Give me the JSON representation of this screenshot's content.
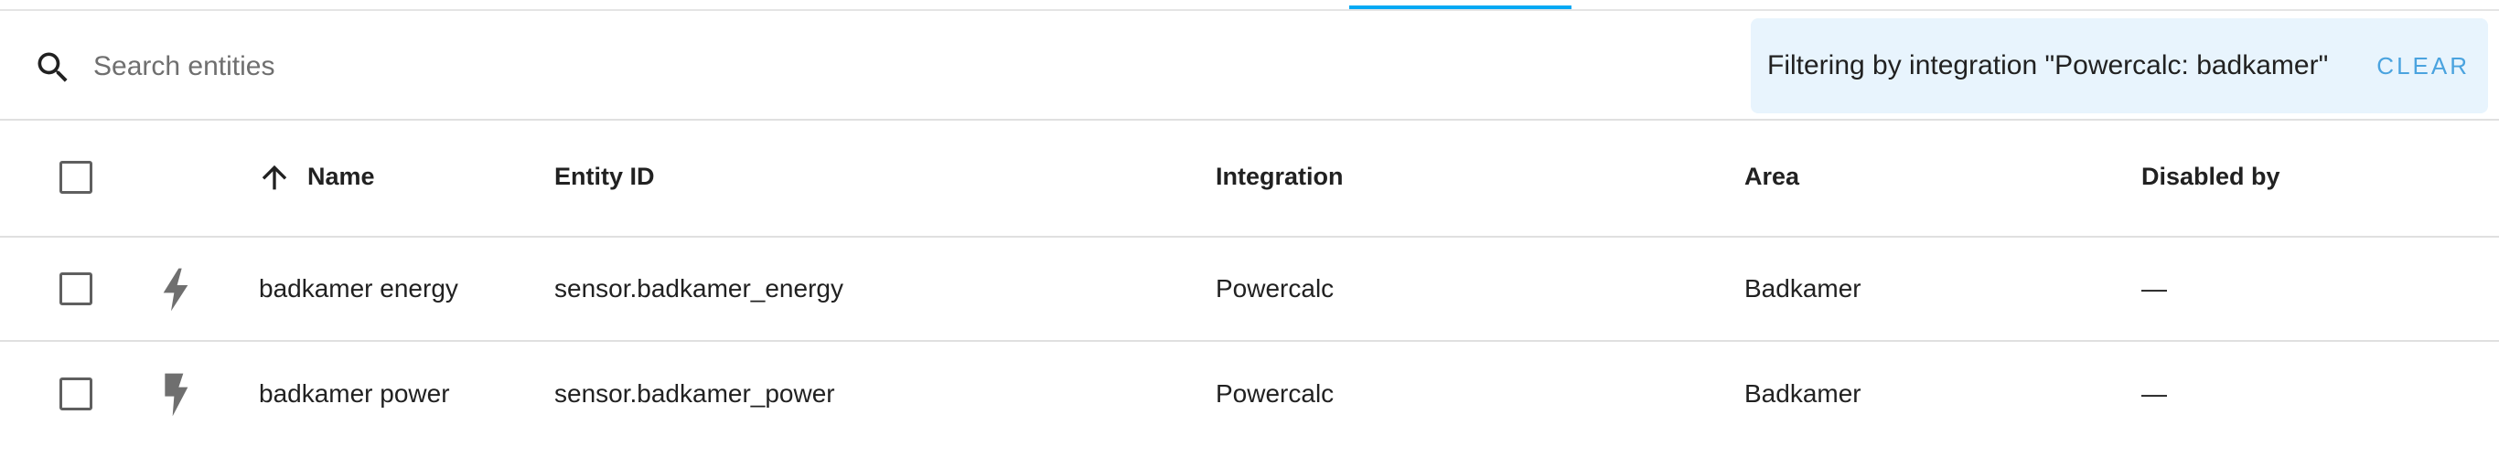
{
  "search": {
    "placeholder": "Search entities",
    "value": ""
  },
  "filter": {
    "text": "Filtering by integration \"Powercalc: badkamer\"",
    "clear_label": "CLEAR"
  },
  "table": {
    "columns": {
      "name": "Name",
      "entity_id": "Entity ID",
      "integration": "Integration",
      "area": "Area",
      "disabled_by": "Disabled by"
    },
    "sort": {
      "column": "Name",
      "direction": "ascending"
    },
    "rows": [
      {
        "icon": "lightning-bolt-icon",
        "name": "badkamer energy",
        "entity_id": "sensor.badkamer_energy",
        "integration": "Powercalc",
        "area": "Badkamer",
        "disabled_by": "—"
      },
      {
        "icon": "flash-icon",
        "name": "badkamer power",
        "entity_id": "sensor.badkamer_power",
        "integration": "Powercalc",
        "area": "Badkamer",
        "disabled_by": "—"
      }
    ]
  },
  "colors": {
    "accent": "#03a9f4",
    "filter_background": "#e8f4fd",
    "clear_text": "#4aa3df"
  }
}
